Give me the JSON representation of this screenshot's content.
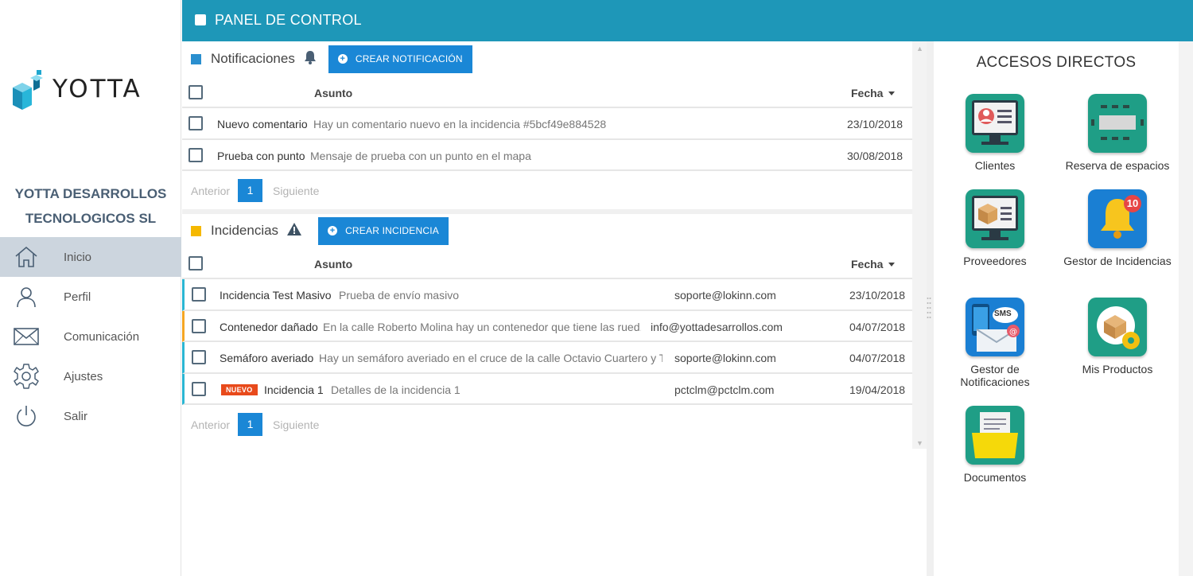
{
  "brand": {
    "logo_text": "YOTTA",
    "company": "YOTTA DESARROLLOS TECNOLOGICOS SL"
  },
  "nav": [
    {
      "label": "Inicio",
      "icon": "home-icon",
      "active": true
    },
    {
      "label": "Perfil",
      "icon": "user-icon",
      "active": false
    },
    {
      "label": "Comunicación",
      "icon": "mail-icon",
      "active": false
    },
    {
      "label": "Ajustes",
      "icon": "gear-icon",
      "active": false
    },
    {
      "label": "Salir",
      "icon": "power-icon",
      "active": false
    }
  ],
  "header": {
    "title": "PANEL DE CONTROL"
  },
  "notificaciones": {
    "title": "Notificaciones",
    "button": "CREAR NOTIFICACIÓN",
    "col_asunto": "Asunto",
    "col_fecha": "Fecha",
    "rows": [
      {
        "title": "Nuevo comentario",
        "desc": "Hay un comentario nuevo en la incidencia #5bcf49e884528",
        "date": "23/10/2018"
      },
      {
        "title": "Prueba con punto",
        "desc": "Mensaje de prueba con un punto en el mapa",
        "date": "30/08/2018"
      }
    ],
    "pager": {
      "prev": "Anterior",
      "page": "1",
      "next": "Siguiente"
    }
  },
  "incidencias": {
    "title": "Incidencias",
    "button": "CREAR INCIDENCIA",
    "col_asunto": "Asunto",
    "col_fecha": "Fecha",
    "badge": "NUEVO",
    "rows": [
      {
        "title": "Incidencia Test Masivo",
        "desc": "Prueba de envío masivo",
        "email": "soporte@lokinn.com",
        "date": "23/10/2018"
      },
      {
        "title": "Contenedor dañado",
        "desc": "En la calle Roberto Molina hay un contenedor que tiene las rued...",
        "email": "info@yottadesarrollos.com",
        "date": "04/07/2018"
      },
      {
        "title": "Semáforo averiado",
        "desc": "Hay un semáforo averiado en el cruce de la calle Octavio Cuartero y T...",
        "email": "soporte@lokinn.com",
        "date": "04/07/2018"
      },
      {
        "title": "Incidencia 1",
        "desc": "Detalles de la incidencia 1",
        "email": "pctclm@pctclm.com",
        "date": "19/04/2018"
      }
    ],
    "pager": {
      "prev": "Anterior",
      "page": "1",
      "next": "Siguiente"
    }
  },
  "accesos": {
    "title": "ACCESOS DIRECTOS",
    "tiles": [
      {
        "label": "Clientes",
        "icon": "clients-icon"
      },
      {
        "label": "Reserva de espacios",
        "icon": "room-reservation-icon"
      },
      {
        "label": "Proveedores",
        "icon": "suppliers-icon"
      },
      {
        "label": "Gestor de Incidencias",
        "icon": "incident-bell-icon",
        "badge": "10"
      },
      {
        "label": "Gestor de Notificaciones",
        "icon": "notifications-sms-icon",
        "sms": "SMS"
      },
      {
        "label": "Mis Productos",
        "icon": "products-icon"
      },
      {
        "label": "Documentos",
        "icon": "documents-folder-icon"
      }
    ]
  },
  "colors": {
    "accent": "#1e97b8",
    "button": "#1a87d6",
    "teal_tile": "#1f9e86",
    "badge_new": "#e84a1b",
    "notif_square": "#2a8fcf",
    "incid_square": "#f5b800"
  }
}
